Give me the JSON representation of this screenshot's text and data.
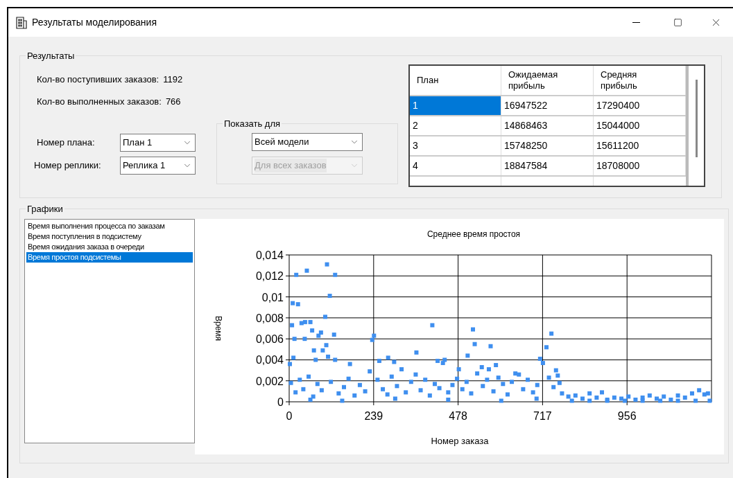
{
  "window": {
    "title": "Результаты моделирования"
  },
  "results": {
    "title": "Результаты",
    "stats": [
      {
        "label": "Кол-во поступивших заказов:",
        "value": "1192"
      },
      {
        "label": "Кол-во выполненных заказов:",
        "value": "766"
      }
    ],
    "selectors": [
      {
        "label": "Номер плана:",
        "value": "План 1",
        "disabled": false
      },
      {
        "label": "Номер реплики:",
        "value": "Реплика 1",
        "disabled": false
      }
    ],
    "show_for": {
      "title": "Показать для",
      "combos": [
        {
          "value": "Всей модели",
          "disabled": false
        },
        {
          "value": "Для всех заказов",
          "disabled": true
        }
      ]
    },
    "table": {
      "columns": [
        "План",
        "Ожидаемая прибыль",
        "Средняя прибыль"
      ],
      "rows": [
        {
          "cells": [
            "1",
            "16947522",
            "17290400"
          ],
          "selected": true
        },
        {
          "cells": [
            "2",
            "14868463",
            "15044000"
          ],
          "selected": false
        },
        {
          "cells": [
            "3",
            "15748250",
            "15611200"
          ],
          "selected": false
        },
        {
          "cells": [
            "4",
            "18847584",
            "18708000"
          ],
          "selected": false
        }
      ]
    }
  },
  "charts": {
    "title": "Графики",
    "list": [
      {
        "label": "Время выполнения процесса по заказам",
        "selected": false
      },
      {
        "label": "Время поступления в подсистему",
        "selected": false
      },
      {
        "label": "Время ожидания заказа в очереди",
        "selected": false
      },
      {
        "label": "Время простоя подсистемы",
        "selected": true
      }
    ],
    "chart_data": {
      "type": "scatter",
      "title": "Среднее время простоя",
      "xlabel": "Номер заказа",
      "ylabel": "Время",
      "xlim": [
        0,
        1195
      ],
      "ylim": [
        0,
        0.014
      ],
      "xticks": [
        0,
        239,
        478,
        717,
        956
      ],
      "yticks": [
        {
          "value": 0,
          "label": "0"
        },
        {
          "value": 0.002,
          "label": "0,002"
        },
        {
          "value": 0.004,
          "label": "0,004"
        },
        {
          "value": 0.006,
          "label": "0,006"
        },
        {
          "value": 0.008,
          "label": "0,008"
        },
        {
          "value": 0.01,
          "label": "0,01"
        },
        {
          "value": 0.012,
          "label": "0,012"
        },
        {
          "value": 0.014,
          "label": "0,014"
        }
      ],
      "x": [
        20,
        50,
        107,
        130,
        115,
        10,
        25,
        102,
        8,
        35,
        45,
        60,
        65,
        90,
        83,
        127,
        15,
        44,
        235,
        240,
        405,
        520,
        525,
        570,
        742,
        728,
        505,
        360,
        105,
        95,
        70,
        2,
        12,
        75,
        110,
        130,
        172,
        280,
        297,
        255,
        420,
        440,
        435,
        480,
        585,
        710,
        718,
        755,
        760,
        640,
        650,
        545,
        565,
        5,
        18,
        30,
        40,
        55,
        68,
        80,
        92,
        118,
        140,
        155,
        168,
        185,
        200,
        215,
        228,
        250,
        265,
        278,
        290,
        305,
        318,
        330,
        345,
        358,
        372,
        385,
        398,
        412,
        425,
        450,
        462,
        475,
        490,
        502,
        515,
        532,
        548,
        560,
        578,
        592,
        605,
        618,
        630,
        662,
        675,
        690,
        702,
        735,
        748,
        765,
        772,
        60,
        150,
        300,
        450,
        600,
        700,
        790,
        810,
        830,
        850,
        870,
        885,
        900,
        920,
        940,
        960,
        980,
        1000,
        1020,
        1040,
        1060,
        1080,
        1100,
        1120,
        1140,
        1160,
        1175,
        1185,
        800,
        850,
        900,
        950,
        1000,
        1050,
        1100,
        1150,
        1190
      ],
      "grid": true,
      "series": [
        {
          "color": "#3f8fef",
          "values": [
            0.0121,
            0.0125,
            0.0131,
            0.0121,
            0.0101,
            0.0094,
            0.0093,
            0.0081,
            0.0073,
            0.0075,
            0.0076,
            0.0076,
            0.0068,
            0.0066,
            0.0063,
            0.0064,
            0.006,
            0.006,
            0.0059,
            0.0063,
            0.0073,
            0.0069,
            0.0055,
            0.0053,
            0.0065,
            0.0052,
            0.0044,
            0.0047,
            0.0054,
            0.0049,
            0.0049,
            0.0036,
            0.0042,
            0.004,
            0.0043,
            0.004,
            0.0036,
            0.0042,
            0.0038,
            0.0039,
            0.0039,
            0.004,
            0.0037,
            0.0031,
            0.0035,
            0.0041,
            0.0037,
            0.003,
            0.0025,
            0.0027,
            0.0026,
            0.0033,
            0.0031,
            0.0018,
            0.0009,
            0.0021,
            0.0012,
            0.0024,
            0.0005,
            0.0017,
            0.0011,
            0.0019,
            0.0008,
            0.0014,
            0.0022,
            0.0006,
            0.0016,
            0.001,
            0.0029,
            0.0021,
            0.0012,
            0.0007,
            0.0024,
            0.0015,
            0.0031,
            0.0009,
            0.0019,
            0.0026,
            0.0011,
            0.0021,
            0.0006,
            0.0017,
            0.0013,
            0.0009,
            0.0016,
            0.0022,
            0.0012,
            0.0019,
            0.0008,
            0.0027,
            0.0015,
            0.0021,
            0.001,
            0.0023,
            0.0017,
            0.0007,
            0.0019,
            0.0012,
            0.0021,
            0.0009,
            0.0016,
            0.0023,
            0.0014,
            0.0018,
            0.0008,
            0.0002,
            0.0001,
            0.0003,
            0.0002,
            0.0001,
            0.0003,
            0.0005,
            0.0006,
            0.0003,
            0.0008,
            0.0004,
            0.0009,
            0.0002,
            0.0004,
            0.0003,
            0.0005,
            0.0002,
            0.0004,
            0.0006,
            0.0003,
            0.0005,
            0.0002,
            0.0006,
            0.0004,
            0.0008,
            0.0011,
            0.0007,
            0.0008,
            0.0001,
            0.0001,
            0.0001,
            0.0001,
            0.0001,
            0.0001,
            0.0001,
            0.0001,
            0.0001
          ]
        }
      ]
    }
  }
}
